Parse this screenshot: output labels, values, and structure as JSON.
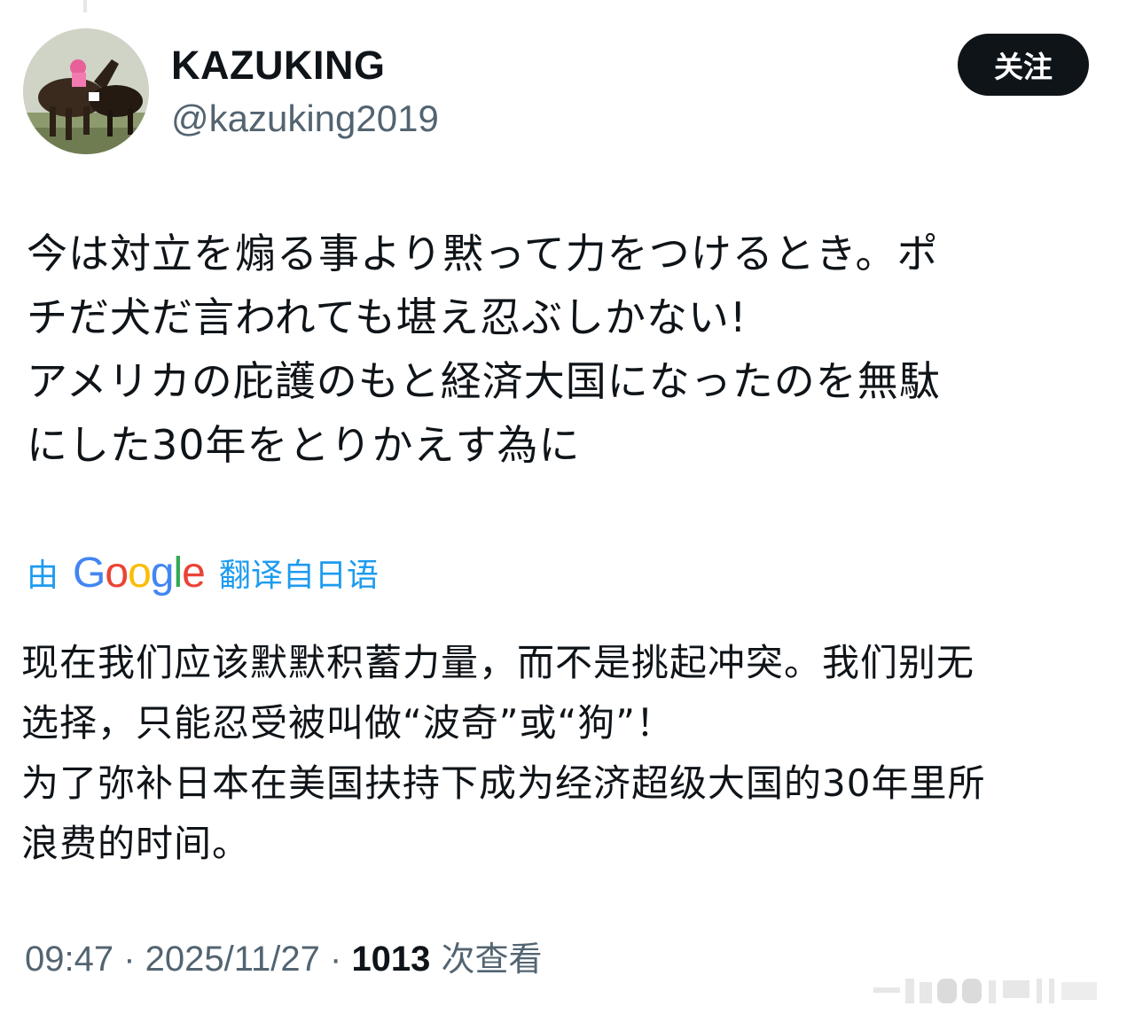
{
  "author": {
    "display_name": "KAZUKING",
    "handle": "@kazuking2019"
  },
  "follow_button_label": "关注",
  "tweet": {
    "text": "今は対立を煽る事より黙って力をつけるとき。ポ\nチだ犬だ言われても堪え忍ぶしかない!\nアメリカの庇護のもと経済大国になったのを無駄\nにした30年をとりかえす為に"
  },
  "translation": {
    "prefix": "由",
    "provider_letters": [
      "G",
      "o",
      "o",
      "g",
      "l",
      "e"
    ],
    "provider_colors": [
      "#4285F4",
      "#EA4335",
      "#FBBC05",
      "#4285F4",
      "#34A853",
      "#EA4335"
    ],
    "suffix": "翻译自日语",
    "text": "现在我们应该默默积蓄力量，而不是挑起冲突。我们别无\n选择，只能忍受被叫做“波奇”或“狗”！\n为了弥补日本在美国扶持下成为经济超级大国的30年里所\n浪费的时间。"
  },
  "meta": {
    "time": "09:47",
    "separator": " · ",
    "date": "2025/11/27",
    "views_count": "1013",
    "views_label": " 次查看"
  },
  "colors": {
    "text": "#0f1419",
    "secondary": "#536471",
    "link": "#1d9bf0",
    "button_bg": "#0f1419"
  }
}
